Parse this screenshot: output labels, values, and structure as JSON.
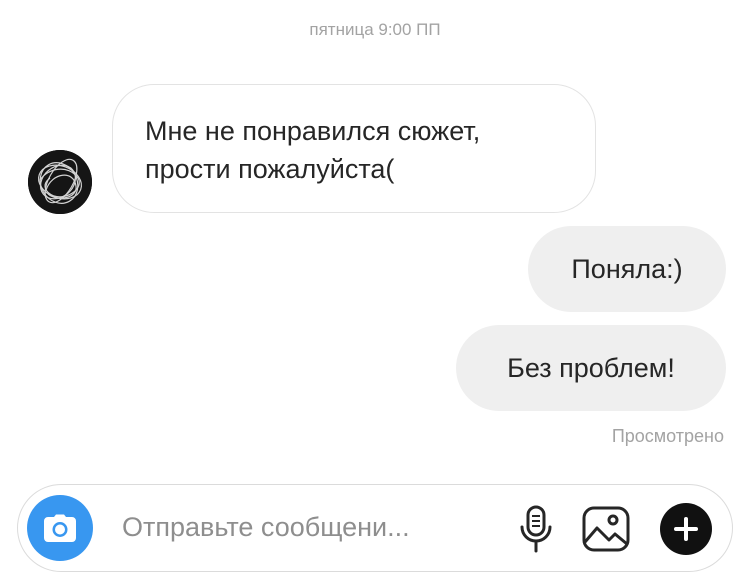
{
  "thread": {
    "timestamp": "пятница 9:00 ПП",
    "messages": [
      {
        "direction": "incoming",
        "lines": [
          "Мне не понравился сюжет,",
          "прости пожалуйста("
        ]
      },
      {
        "direction": "outgoing",
        "text": "Поняла:)"
      },
      {
        "direction": "outgoing",
        "text": "Без проблем!"
      }
    ],
    "seen_status": "Просмотрено"
  },
  "composer": {
    "placeholder": "Отправьте сообщени...",
    "value": ""
  },
  "icons": {
    "camera": "camera-icon",
    "mic": "microphone-icon",
    "gallery": "gallery-icon",
    "plus": "plus-icon",
    "avatar": "avatar"
  },
  "colors": {
    "accent": "#3897f0",
    "outgoing_bubble": "#efefef",
    "muted_text": "#a3a3a3"
  }
}
